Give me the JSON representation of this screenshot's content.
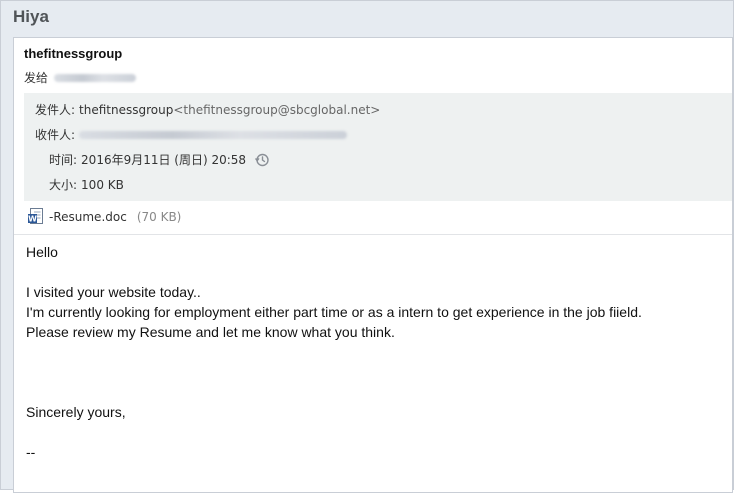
{
  "email": {
    "subject": "Hiya",
    "sender_name": "thefitnessgroup",
    "to_label": "发给",
    "details": {
      "from_label": "发件人:",
      "from_name": "thefitnessgroup",
      "from_email": "<thefitnessgroup@sbcglobal.net>",
      "recipient_label": "收件人:",
      "time_label": "时间:",
      "time_value": "2016年9月11日 (周日) 20:58",
      "size_label": "大小:",
      "size_value": "100 KB"
    },
    "attachment": {
      "name": "-Resume.doc",
      "size": "(70 KB)",
      "icon": "word-doc-icon"
    },
    "body_lines": [
      "Hello",
      "",
      "I visited your website today..",
      "I'm currently looking for employment either part time or as a intern to get experience in the job fiield.",
      "Please review my Resume and let me know what you think.",
      "",
      "",
      "",
      "Sincerely yours,",
      "",
      "--"
    ]
  },
  "colors": {
    "frame_bg": "#e6ebf1",
    "meta_bg": "#eef1f1",
    "doc_icon_blue": "#2b5797"
  }
}
